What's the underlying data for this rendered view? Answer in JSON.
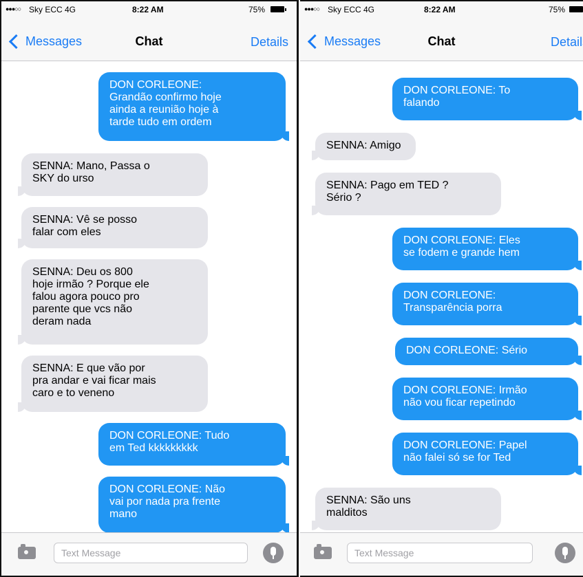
{
  "status_bar": {
    "carrier": "Sky ECC  4G",
    "time": "8:22 AM",
    "battery": "75%"
  },
  "nav": {
    "back_label": "Messages",
    "title": "Chat",
    "details_label": "Details"
  },
  "input": {
    "placeholder": "Text Message"
  },
  "left_messages": [
    {
      "sender": "out",
      "text": "DON CORLEONE:\nGrandão confirmo hoje\nainda a reunião hoje à\ntarde tudo em ordem"
    },
    {
      "sender": "in",
      "text": "SENNA: Mano, Passa o\nSKY do urso"
    },
    {
      "sender": "in",
      "text": "SENNA: Vê se posso\nfalar com eles"
    },
    {
      "sender": "in",
      "text": "SENNA: Deu os 800\nhoje irmão ? Porque ele\nfalou agora pouco pro\nparente que vcs não\nderam nada"
    },
    {
      "sender": "in",
      "text": "SENNA: E que vão por\npra andar e vai ficar mais\ncaro e to veneno"
    },
    {
      "sender": "out",
      "text": "DON CORLEONE: Tudo\nem Ted kkkkkkkkk"
    },
    {
      "sender": "out",
      "text": "DON CORLEONE: Não\nvai por nada pra frente\nmano"
    }
  ],
  "right_messages": [
    {
      "sender": "out",
      "text": "DON CORLEONE: To\nfalando"
    },
    {
      "sender": "in",
      "text": "SENNA: Amigo"
    },
    {
      "sender": "in",
      "text": "SENNA: Pago em TED ?\nSério ?"
    },
    {
      "sender": "out",
      "text": "DON CORLEONE: Eles\nse fodem e grande hem"
    },
    {
      "sender": "out",
      "text": "DON CORLEONE:\nTransparência porra"
    },
    {
      "sender": "out",
      "text": "DON CORLEONE: Sério"
    },
    {
      "sender": "out",
      "text": "DON CORLEONE: Irmão\nnão vou ficar repetindo"
    },
    {
      "sender": "out",
      "text": "DON CORLEONE: Papel\nnão falei só se for Ted"
    },
    {
      "sender": "in",
      "text": "SENNA: São uns\nmalditos"
    }
  ],
  "colors": {
    "accent": "#1a7cf5",
    "outgoing_bubble": "#2196f3",
    "incoming_bubble": "#e5e5ea"
  }
}
